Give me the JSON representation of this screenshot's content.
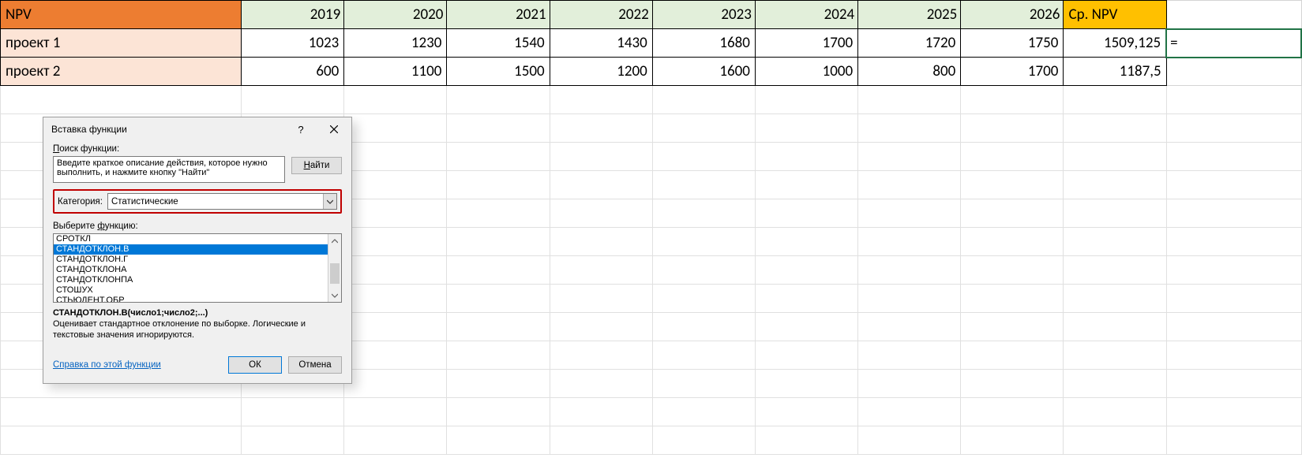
{
  "table": {
    "header_label": "NPV",
    "years": [
      "2019",
      "2020",
      "2021",
      "2022",
      "2023",
      "2024",
      "2025",
      "2026"
    ],
    "avg_header": "Ср. NPV",
    "rows": [
      {
        "label": "проект 1",
        "values": [
          "1023",
          "1230",
          "1540",
          "1430",
          "1680",
          "1700",
          "1720",
          "1750"
        ],
        "avg": "1509,125"
      },
      {
        "label": "проект 2",
        "values": [
          "600",
          "1100",
          "1500",
          "1200",
          "1600",
          "1000",
          "800",
          "1700"
        ],
        "avg": "1187,5"
      }
    ],
    "formula_cell": "="
  },
  "dialog": {
    "title": "Вставка функции",
    "help_symbol": "?",
    "search_label_pre": "П",
    "search_label_rest": "оиск функции:",
    "search_text": "Введите краткое описание действия, которое нужно выполнить, и нажмите кнопку \"Найти\"",
    "find_btn_pre": "Н",
    "find_btn_rest": "айти",
    "category_label_pre": "К",
    "category_label_rest": "атегория:",
    "category_value": "Статистические",
    "select_fn_label_pre": "Выберите ",
    "select_fn_label_u": "ф",
    "select_fn_label_rest": "ункцию:",
    "functions": [
      {
        "name": "СРОТКЛ",
        "sel": false
      },
      {
        "name": "СТАНДОТКЛОН.В",
        "sel": true
      },
      {
        "name": "СТАНДОТКЛОН.Г",
        "sel": false
      },
      {
        "name": "СТАНДОТКЛОНА",
        "sel": false
      },
      {
        "name": "СТАНДОТКЛОНПА",
        "sel": false
      },
      {
        "name": "СТОШУХ",
        "sel": false
      },
      {
        "name": "СТЬЮДЕНТ.ОБР",
        "sel": false
      }
    ],
    "fn_signature": "СТАНДОТКЛОН.В(число1;число2;...)",
    "fn_description": "Оценивает стандартное отклонение по выборке. Логические и текстовые значения игнорируются.",
    "help_link": "Справка по этой функции",
    "ok": "ОК",
    "cancel": "Отмена"
  }
}
